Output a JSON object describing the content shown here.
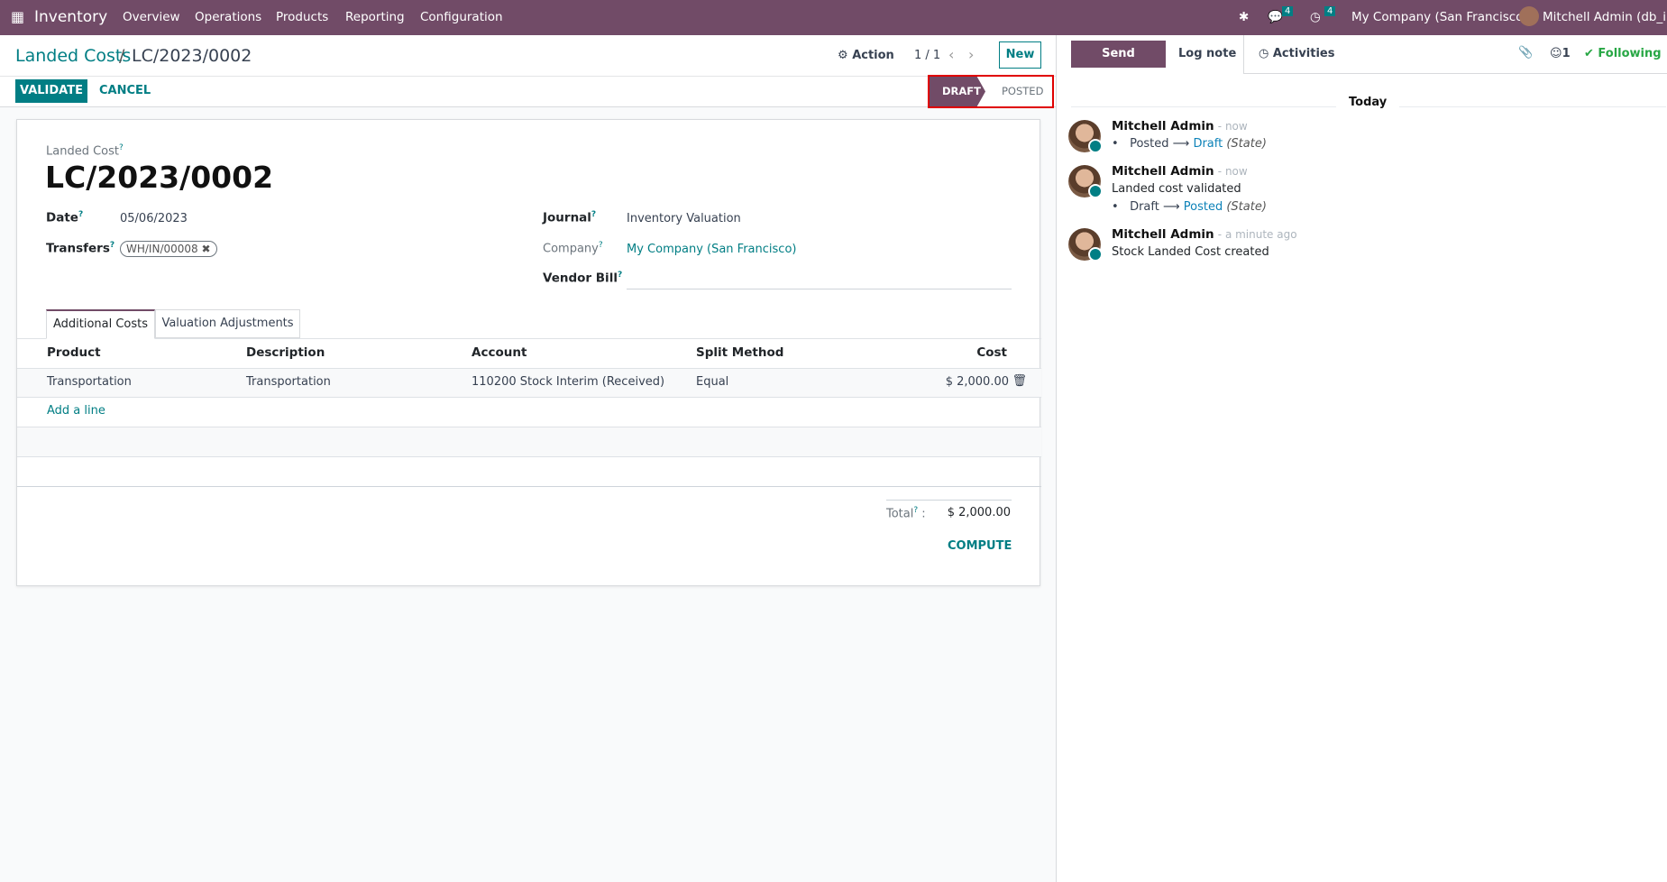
{
  "navbar": {
    "app": "Inventory",
    "menus": [
      "Overview",
      "Operations",
      "Products",
      "Reporting",
      "Configuration"
    ],
    "messages_count": "4",
    "activities_count": "4",
    "company": "My Company (San Francisco)",
    "user": "Mitchell Admin (db_ii)"
  },
  "control": {
    "breadcrumb_parent": "Landed Costs",
    "breadcrumb_sep": "/",
    "breadcrumb_current": "LC/2023/0002",
    "action": "Action",
    "pager": "1 / 1",
    "new": "New",
    "validate": "VALIDATE",
    "cancel": "CANCEL",
    "status": [
      "DRAFT",
      "POSTED"
    ],
    "status_active": "DRAFT"
  },
  "form": {
    "name_label": "Landed Cost",
    "name": "LC/2023/0002",
    "date_label": "Date",
    "date": "05/06/2023",
    "transfers_label": "Transfers",
    "transfer_tag": "WH/IN/00008",
    "journal_label": "Journal",
    "journal": "Inventory Valuation",
    "company_label": "Company",
    "company": "My Company (San Francisco)",
    "vendor_bill_label": "Vendor Bill",
    "vendor_bill": "",
    "help": "?",
    "tabs": [
      "Additional Costs",
      "Valuation Adjustments"
    ],
    "columns": [
      "Product",
      "Description",
      "Account",
      "Split Method",
      "Cost"
    ],
    "lines": [
      {
        "product": "Transportation",
        "description": "Transportation",
        "account": "110200 Stock Interim (Received)",
        "split": "Equal",
        "cost": "$ 2,000.00"
      }
    ],
    "add_line": "Add a line",
    "total_label": "Total",
    "total": "$ 2,000.00",
    "compute": "COMPUTE"
  },
  "chatter": {
    "send_message": "Send message",
    "log_note": "Log note",
    "activities": "Activities",
    "followers": "1",
    "following": "Following",
    "today": "Today",
    "messages": [
      {
        "author": "Mitchell Admin",
        "time": "- now",
        "body": "",
        "old": "Posted",
        "new": "Draft",
        "field": "(State)"
      },
      {
        "author": "Mitchell Admin",
        "time": "- now",
        "body": "Landed cost validated",
        "old": "Draft",
        "new": "Posted",
        "field": "(State)"
      },
      {
        "author": "Mitchell Admin",
        "time": "- a minute ago",
        "body": "Stock Landed Cost created"
      }
    ]
  },
  "colors": {
    "brand": "#714b67",
    "accent": "#017e84",
    "highlight": "#e00000"
  }
}
